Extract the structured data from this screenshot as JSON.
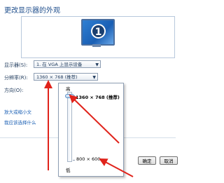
{
  "page_title": "更改显示器的外观",
  "monitor": {
    "number": "1"
  },
  "form": {
    "display_label": "显示器(S):",
    "display_value": "1. 在 VGA 上显示设备",
    "resolution_label": "分辨率(R):",
    "resolution_value": "1360 × 768 (推荐)",
    "orientation_label": "方向(O):"
  },
  "links": {
    "link1": "放大或缩小文",
    "link2": "我应该选择什么"
  },
  "buttons": {
    "ok": "确定",
    "cancel": "取消"
  },
  "slider_popup": {
    "high_label": "高",
    "low_label": "低",
    "top_resolution": "1360 × 768 (推荐)",
    "bottom_resolution": "800 × 600",
    "level": 1.0
  },
  "colors": {
    "arrow": "#e0231b",
    "accent": "#1a5fb4"
  }
}
